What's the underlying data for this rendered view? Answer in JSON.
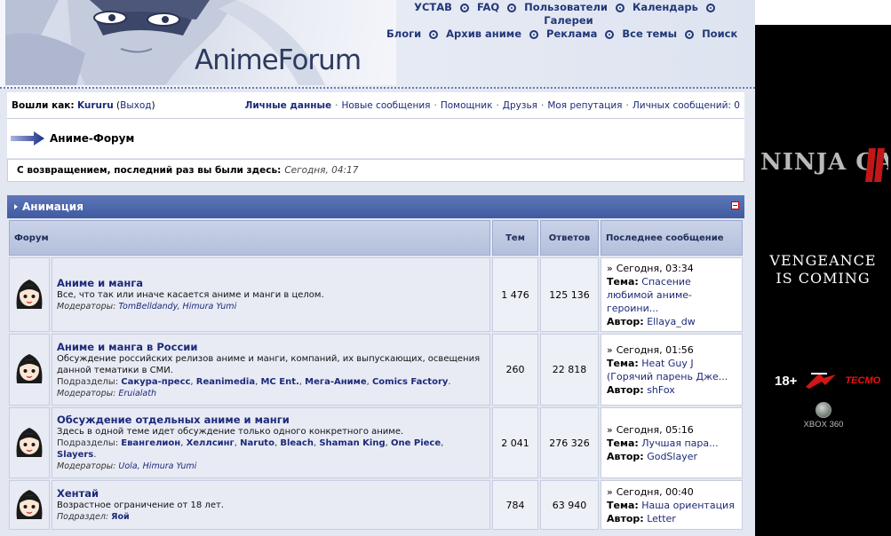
{
  "header": {
    "logo": "AnimeForum",
    "nav_row1": [
      "УСТАВ",
      "FAQ",
      "Пользователи",
      "Календарь"
    ],
    "nav_row2": [
      "Галереи"
    ],
    "nav_row3": [
      "Блоги",
      "Архив аниме",
      "Реклама",
      "Все темы",
      "Поиск"
    ]
  },
  "userbar": {
    "logged_as": "Вошли как:",
    "username": "Kururu",
    "logout": "Выход",
    "links": [
      "Личные данные",
      "Новые сообщения",
      "Помощник",
      "Друзья",
      "Моя репутация",
      "Личных сообщений: 0"
    ]
  },
  "breadcrumb": {
    "title": "Аниме-Форум"
  },
  "welcome": {
    "text": "С возвращением, последний раз вы были здесь:",
    "time": "Сегодня, 04:17"
  },
  "category": {
    "title": "Анимация"
  },
  "table": {
    "headers": {
      "forum": "Форум",
      "topics": "Тем",
      "replies": "Ответов",
      "last_post": "Последнее сообщение"
    },
    "rows": [
      {
        "title": "Аниме и манга",
        "desc": "Все, что так или иначе касается аниме и манги в целом.",
        "subforums_label": "",
        "subforums": [],
        "mods_label": "Модераторы:",
        "mods": "TomBelldandy, Himura Yumi",
        "topics": "1 476",
        "replies": "125 136",
        "last_date": "Сегодня, 03:34",
        "topic_label": "Тема:",
        "topic": "Спасение любимой аниме-героини...",
        "author_label": "Автор:",
        "author": "Ellaya_dw"
      },
      {
        "title": "Аниме и манга в России",
        "desc": "Обсуждение российских релизов аниме и манги, компаний, их выпускающих, освещения данной тематики в СМИ.",
        "subforums_label": "Подразделы:",
        "subforums": [
          "Сакура-пресс",
          "Reanimedia",
          "MC Ent.",
          "Мега-Аниме",
          "Comics Factory"
        ],
        "mods_label": "Модераторы:",
        "mods": "Eruialath",
        "topics": "260",
        "replies": "22 818",
        "last_date": "Сегодня, 01:56",
        "topic_label": "Тема:",
        "topic": "Heat Guy J (Горячий парень Дже...",
        "author_label": "Автор:",
        "author": "shFox"
      },
      {
        "title": "Обсуждение отдельных аниме и манги",
        "desc": "Здесь в одной теме идет обсуждение только одного конкретного аниме.",
        "subforums_label": "Подразделы:",
        "subforums": [
          "Евангелион",
          "Хеллсинг",
          "Naruto",
          "Bleach",
          "Shaman King",
          "One Piece",
          "Slayers"
        ],
        "mods_label": "Модераторы:",
        "mods": "Uola, Himura Yumi",
        "topics": "2 041",
        "replies": "276 326",
        "last_date": "Сегодня, 05:16",
        "topic_label": "Тема:",
        "topic": "Лучшая пара...",
        "author_label": "Автор:",
        "author": "GodSlayer"
      },
      {
        "title": "Хентай",
        "desc": "Возрастное ограничение от 18 лет.",
        "subforums_label": "Подраздел:",
        "subforums": [
          "Яой"
        ],
        "mods_label": "",
        "mods": "",
        "topics": "784",
        "replies": "63 940",
        "last_date": "Сегодня, 00:40",
        "topic_label": "Тема:",
        "topic": "Наша ориентация",
        "author_label": "Автор:",
        "author": "Letter"
      }
    ]
  },
  "ad": {
    "game_logo": "NINJA GAIDEN II",
    "tagline_1": "VENGEANCE",
    "tagline_2": "IS COMING",
    "rating": "18+",
    "publisher": "TECMO",
    "platform": "XBOX 360"
  }
}
